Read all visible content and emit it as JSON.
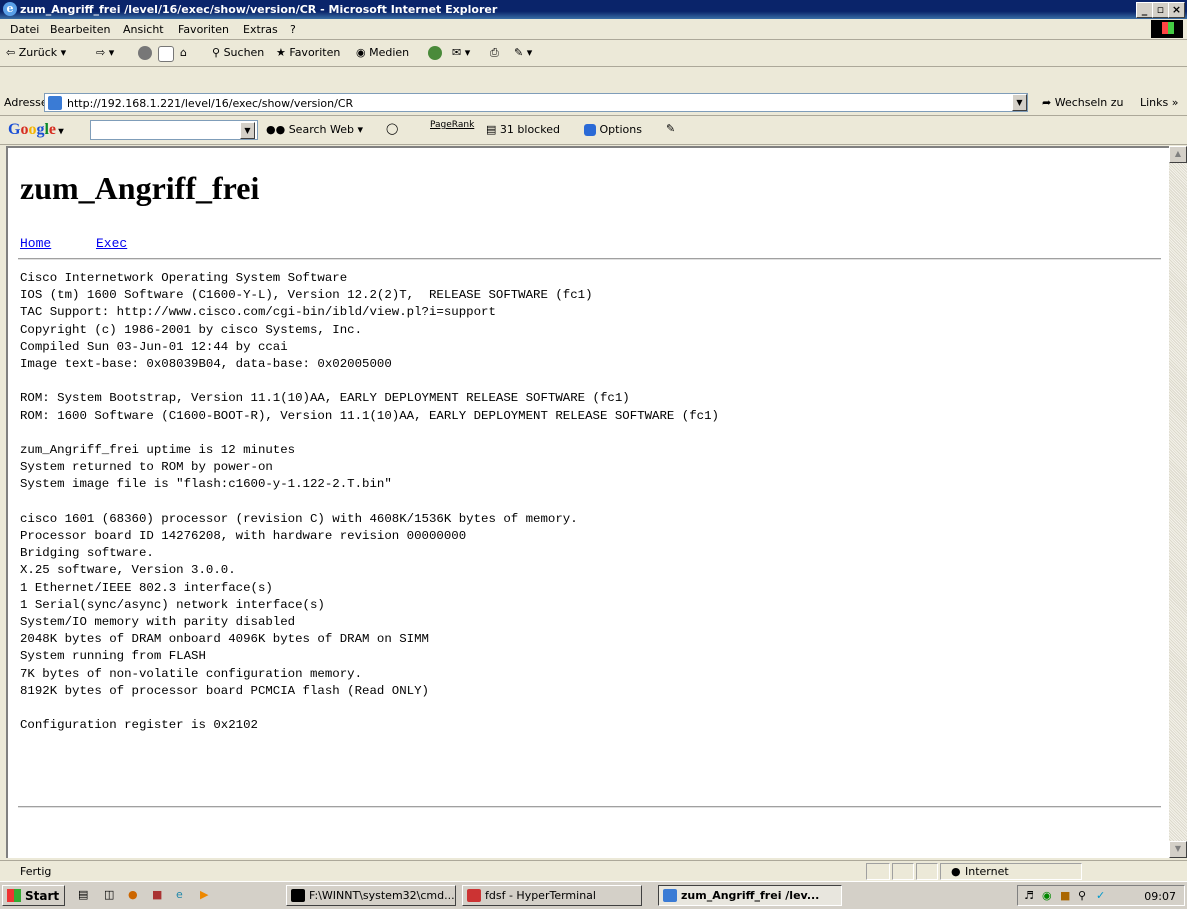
{
  "window": {
    "title": "zum_Angriff_frei /level/16/exec/show/version/CR - Microsoft Internet Explorer",
    "buttons": [
      "_",
      "×"
    ]
  },
  "menu": [
    "Datei",
    "Bearbeiten",
    "Ansicht",
    "Favoriten",
    "Extras",
    "?"
  ],
  "toolbar": {
    "back": "Zurück",
    "search": "Suchen",
    "favorites": "Favoriten",
    "media": "Medien"
  },
  "address": {
    "label": "Adresse",
    "url": "http://192.168.1.221/level/16/exec/show/version/CR",
    "go": "Wechseln zu",
    "links": "Links »"
  },
  "googlebar": {
    "logo": "Google",
    "search_web": "Search Web",
    "pagerank": "PageRank",
    "blocked": "31 blocked",
    "options": "Options"
  },
  "page": {
    "title": "zum_Angriff_frei",
    "links": [
      "Home",
      "Exec"
    ],
    "output": "Cisco Internetwork Operating System Software\nIOS (tm) 1600 Software (C1600-Y-L), Version 12.2(2)T,  RELEASE SOFTWARE (fc1)\nTAC Support: http://www.cisco.com/cgi-bin/ibld/view.pl?i=support\nCopyright (c) 1986-2001 by cisco Systems, Inc.\nCompiled Sun 03-Jun-01 12:44 by ccai\nImage text-base: 0x08039B04, data-base: 0x02005000\n\nROM: System Bootstrap, Version 11.1(10)AA, EARLY DEPLOYMENT RELEASE SOFTWARE (fc1)\nROM: 1600 Software (C1600-BOOT-R), Version 11.1(10)AA, EARLY DEPLOYMENT RELEASE SOFTWARE (fc1)\n\nzum_Angriff_frei uptime is 12 minutes\nSystem returned to ROM by power-on\nSystem image file is \"flash:c1600-y-1.122-2.T.bin\"\n\ncisco 1601 (68360) processor (revision C) with 4608K/1536K bytes of memory.\nProcessor board ID 14276208, with hardware revision 00000000\nBridging software.\nX.25 software, Version 3.0.0.\n1 Ethernet/IEEE 802.3 interface(s)\n1 Serial(sync/async) network interface(s)\nSystem/IO memory with parity disabled\n2048K bytes of DRAM onboard 4096K bytes of DRAM on SIMM\nSystem running from FLASH\n7K bytes of non-volatile configuration memory.\n8192K bytes of processor board PCMCIA flash (Read ONLY)\n\nConfiguration register is 0x2102"
  },
  "status": {
    "text": "Fertig",
    "zone": "Internet"
  },
  "taskbar": {
    "start": "Start",
    "tasks": [
      "F:\\WINNT\\system32\\cmd...",
      "fdsf - HyperTerminal",
      "zum_Angriff_frei /lev..."
    ],
    "clock": "09:07"
  },
  "colors": {
    "titlebar": "#0a246a",
    "link": "#0000ee",
    "chrome": "#ece9d8"
  }
}
